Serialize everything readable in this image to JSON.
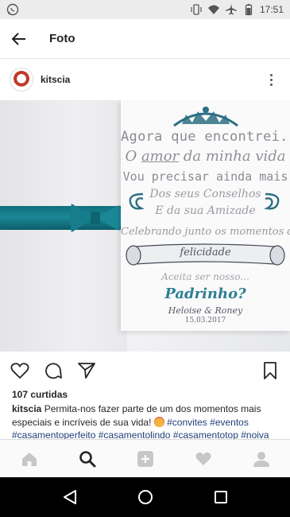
{
  "status_bar": {
    "time": "17:51",
    "icons": [
      "whatsapp-icon",
      "vibrate-icon",
      "wifi-icon",
      "airplane-icon",
      "battery-icon"
    ]
  },
  "toolbar": {
    "title": "Foto",
    "back_icon": "arrow-left-icon"
  },
  "post": {
    "username": "kitscia",
    "more_icon": "vertical-ellipsis-icon"
  },
  "card": {
    "line1": "Agora que encontrei...",
    "line2_prefix": "O ",
    "line2_underlined": "amor",
    "line2_suffix": " da minha vida",
    "line3": "Vou precisar ainda mais",
    "line4": "Dos seus Conselhos",
    "line5": "E da sua Amizade",
    "line6": "Celebrando junto os momentos de",
    "line7": "felicidade",
    "line8": "Aceita ser nosso...",
    "line9": "Padrinho?",
    "line10": "Heloise & Roney",
    "line11": "15.03.2017"
  },
  "actions": {
    "like_icon": "heart-icon",
    "comment_icon": "comment-icon",
    "share_icon": "send-icon",
    "save_icon": "bookmark-icon"
  },
  "likes": "107 curtidas",
  "caption": {
    "user": "kitscia",
    "text": " Permita-nos fazer parte de um dos momentos mais especiais e incríveis de sua vida! ",
    "tags": [
      "#convites",
      "#eventos",
      "#casamentoperfeito",
      "#casamentolindo",
      "#casamentotop",
      "#noiva"
    ]
  },
  "tabbar": {
    "items": [
      "home-icon",
      "search-icon",
      "add-icon",
      "activity-heart-icon",
      "profile-icon"
    ]
  },
  "navbar": {
    "items": [
      "back-triangle-icon",
      "home-circle-icon",
      "recents-square-icon"
    ]
  },
  "colors": {
    "ribbon": "#1b8796",
    "accent_teal": "#2e7f93",
    "hashtag": "#1f3f78"
  }
}
